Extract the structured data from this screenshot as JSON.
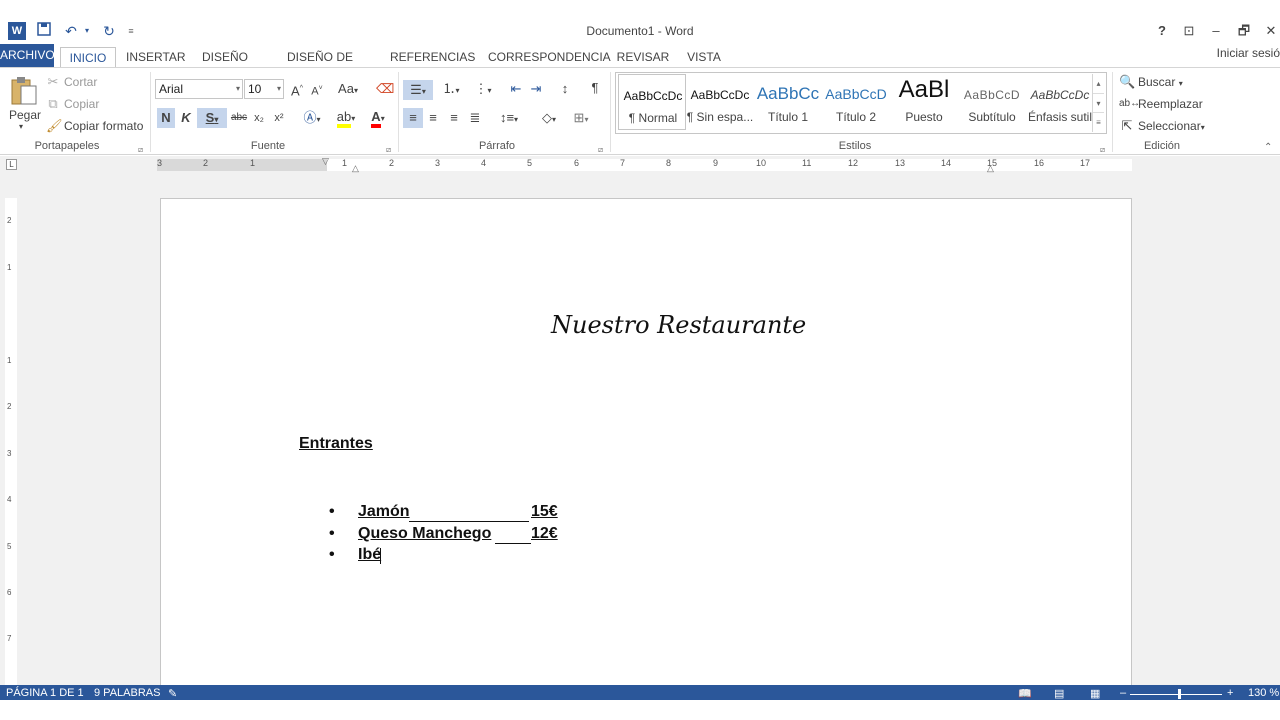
{
  "app": {
    "title": "Documento1 - Word",
    "signin": "Iniciar sesió"
  },
  "qat": {
    "word_icon": "word-logo-icon",
    "save_icon": "save-icon",
    "undo_icon": "undo-icon",
    "redo_icon": "redo-icon",
    "customize_icon": "customize-qat-icon"
  },
  "window_controls": {
    "help": "?",
    "ribbon_display": "⊡",
    "minimize": "–",
    "restore": "🗗",
    "close": "✕"
  },
  "tabs": [
    {
      "label": "ARCHIVO"
    },
    {
      "label": "INICIO"
    },
    {
      "label": "INSERTAR"
    },
    {
      "label": "DISEÑO"
    },
    {
      "label": "DISEÑO DE PÁGINA"
    },
    {
      "label": "REFERENCIAS"
    },
    {
      "label": "CORRESPONDENCIA"
    },
    {
      "label": "REVISAR"
    },
    {
      "label": "VISTA"
    }
  ],
  "clipboard": {
    "paste": "Pegar",
    "cut": "Cortar",
    "copy": "Copiar",
    "format_painter": "Copiar formato",
    "label": "Portapapeles"
  },
  "font": {
    "family": "Arial",
    "size": "10",
    "grow": "A˄",
    "shrink": "A˅",
    "case": "Aa",
    "bold": "N",
    "italic": "K",
    "underline": "S",
    "strike": "abc",
    "subscript": "x₂",
    "superscript": "x²",
    "label": "Fuente"
  },
  "paragraph": {
    "label": "Párrafo",
    "pilcrow": "¶"
  },
  "styles": {
    "label": "Estilos",
    "items": [
      {
        "sample": "AaBbCcDc",
        "name": "¶ Normal"
      },
      {
        "sample": "AaBbCcDc",
        "name": "¶ Sin espa..."
      },
      {
        "sample": "AaBbCc",
        "name": "Título 1"
      },
      {
        "sample": "AaBbCcD",
        "name": "Título 2"
      },
      {
        "sample": "AaBl",
        "name": "Puesto"
      },
      {
        "sample": "AaBbCcD",
        "name": "Subtítulo"
      },
      {
        "sample": "AaBbCcDc",
        "name": "Énfasis sutil"
      }
    ]
  },
  "editing": {
    "find": "Buscar",
    "replace": "Reemplazar",
    "select": "Seleccionar",
    "label": "Edición"
  },
  "ruler": {
    "numbers": [
      "3",
      "2",
      "1",
      "1",
      "2",
      "3",
      "4",
      "5",
      "6",
      "7",
      "8",
      "9",
      "10",
      "11",
      "12",
      "13",
      "14",
      "15",
      "16",
      "17"
    ],
    "vertical_numbers": [
      "2",
      "1",
      "1",
      "2",
      "3",
      "4",
      "5",
      "6",
      "7"
    ]
  },
  "document": {
    "heading": "Nuestro Restaurante",
    "section": "Entrantes",
    "items": [
      {
        "name": "Jamón",
        "price": "15€"
      },
      {
        "name": "Queso Manchego",
        "price": "12€"
      },
      {
        "name": "Ibé",
        "price": ""
      }
    ]
  },
  "status": {
    "page": "PÁGINA 1 DE 1",
    "words": "9 PALABRAS",
    "zoom": "130 %",
    "zoom_out": "–",
    "zoom_in": "+"
  },
  "colors": {
    "accent": "#2b579a",
    "highlight": "#ffff00",
    "font_color": "#ff0000"
  }
}
